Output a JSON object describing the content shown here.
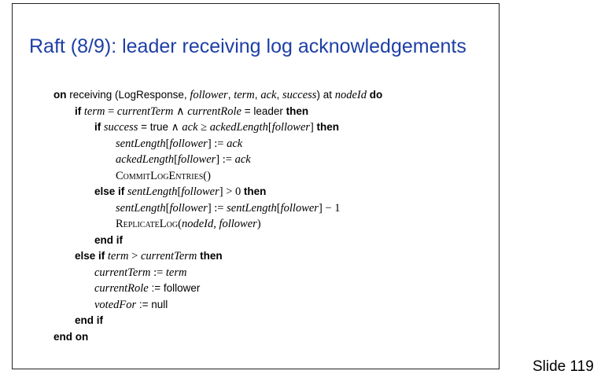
{
  "title": "Raft (8/9): leader receiving log acknowledgements",
  "slide_number": "Slide 119",
  "lines": {
    "l1": {
      "a": "on",
      "b": " receiving (LogResponse, ",
      "c": "follower",
      "d": ", ",
      "e": "term",
      "f": ", ",
      "g": "ack",
      "h": ", ",
      "i": "success",
      "j": ") at ",
      "k": "nodeId",
      "l": " do"
    },
    "l2": {
      "a": "if",
      "b": " term",
      "c": " = ",
      "d": "currentTerm",
      "e": " ∧ ",
      "f": "currentRole",
      "g": " = leader ",
      "h": "then"
    },
    "l3": {
      "a": "if",
      "b": " success",
      "c": " = true ∧ ",
      "d": "ack",
      "e": " ≥ ",
      "f": "ackedLength",
      "g": "[",
      "h": "follower",
      "i": "] ",
      "j": "then"
    },
    "l4": {
      "a": "sentLength",
      "b": "[",
      "c": "follower",
      "d": "] := ",
      "e": "ack"
    },
    "l5": {
      "a": "ackedLength",
      "b": "[",
      "c": "follower",
      "d": "] := ",
      "e": "ack"
    },
    "l6": {
      "a": "CommitLogEntries",
      "b": "()"
    },
    "l7": {
      "a": "else if",
      "b": " sentLength",
      "c": "[",
      "d": "follower",
      "e": "] > 0 ",
      "f": "then"
    },
    "l8": {
      "a": "sentLength",
      "b": "[",
      "c": "follower",
      "d": "] := ",
      "e": "sentLength",
      "f": "[",
      "g": "follower",
      "h": "] − 1"
    },
    "l9": {
      "a": "ReplicateLog",
      "b": "(",
      "c": "nodeId",
      "d": ", ",
      "e": "follower",
      "f": ")"
    },
    "l10": {
      "a": "end if"
    },
    "l11": {
      "a": "else if",
      "b": " term",
      "c": " > ",
      "d": "currentTerm",
      "e": " then"
    },
    "l12": {
      "a": "currentTerm",
      "b": " := ",
      "c": "term"
    },
    "l13": {
      "a": "currentRole",
      "b": " := follower"
    },
    "l14": {
      "a": "votedFor",
      "b": " := null"
    },
    "l15": {
      "a": "end if"
    },
    "l16": {
      "a": "end on"
    }
  }
}
